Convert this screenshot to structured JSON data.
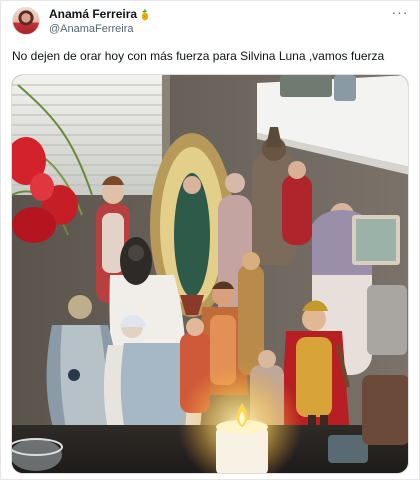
{
  "author": {
    "display_name": "Anamá Ferreira",
    "badge_icon": "pineapple-icon",
    "handle": "@AnamaFerreira"
  },
  "more_icon": "ellipsis-icon",
  "more_label": "···",
  "tweet": {
    "text": "No dejen de orar hoy con más fuerza para Silvina Luna ,vamos fuerza"
  },
  "media": {
    "content": "photo of religious saint statues and a lit candle on a shelf"
  }
}
